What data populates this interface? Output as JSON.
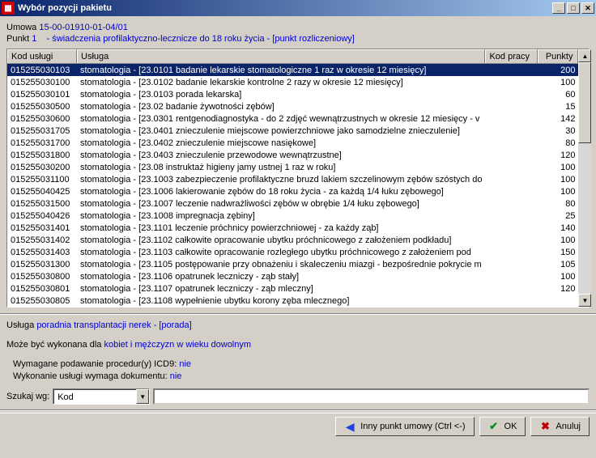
{
  "window": {
    "title": "Wybór pozycji pakietu"
  },
  "header": {
    "umowa_label": "Umowa",
    "umowa_value": "15-00-01910-01-04/01",
    "punkt_label": "Punkt",
    "punkt_value": "1",
    "punkt_desc": "-   świadczenia profilaktyczno-lecznicze do 18 roku życia - [punkt rozliczeniowy]"
  },
  "table": {
    "columns": {
      "kod": "Kod usługi",
      "usluga": "Usługa",
      "kodpracy": "Kod pracy",
      "punkty": "Punkty"
    },
    "rows": [
      {
        "kod": "015255030103",
        "usluga": "stomatologia - [23.0101 badanie lekarskie stomatologiczne 1 raz w okresie 12 miesięcy]",
        "punkty": "200",
        "sel": true
      },
      {
        "kod": "015255030100",
        "usluga": "stomatologia - [23.0102 badanie lekarskie kontrolne 2 razy w okresie 12 miesięcy]",
        "punkty": "100"
      },
      {
        "kod": "015255030101",
        "usluga": "stomatologia - [23.0103 porada lekarska]",
        "punkty": "60"
      },
      {
        "kod": "015255030500",
        "usluga": "stomatologia - [23.02 badanie żywotności zębów]",
        "punkty": "15"
      },
      {
        "kod": "015255030600",
        "usluga": "stomatologia - [23.0301 rentgenodiagnostyka - do 2 zdjęć wewnątrzustnych w okresie 12 miesięcy - v",
        "punkty": "142"
      },
      {
        "kod": "015255031705",
        "usluga": "stomatologia - [23.0401 znieczulenie miejscowe powierzchniowe jako samodzielne znieczulenie]",
        "punkty": "30"
      },
      {
        "kod": "015255031700",
        "usluga": "stomatologia - [23.0402 znieczulenie miejscowe nasiękowe]",
        "punkty": "80"
      },
      {
        "kod": "015255031800",
        "usluga": "stomatologia - [23.0403 znieczulenie przewodowe wewnątrzustne]",
        "punkty": "120"
      },
      {
        "kod": "015255030200",
        "usluga": "stomatologia - [23.08 instruktaż higieny jamy ustnej 1 raz w roku]",
        "punkty": "100"
      },
      {
        "kod": "015255031100",
        "usluga": "stomatologia - [23.1003 zabezpieczenie profilaktyczne bruzd lakiem szczelinowym zębów szóstych do",
        "punkty": "100"
      },
      {
        "kod": "015255040425",
        "usluga": "stomatologia - [23.1006 lakierowanie zębów  do 18 roku życia - za każdą 1/4 łuku zębowego]",
        "punkty": "100"
      },
      {
        "kod": "015255031500",
        "usluga": "stomatologia - [23.1007 leczenie nadwrażliwości zębów w obrębie 1/4 łuku zębowego]",
        "punkty": "80"
      },
      {
        "kod": "015255040426",
        "usluga": "stomatologia - [23.1008 impregnacja zębiny]",
        "punkty": "25"
      },
      {
        "kod": "015255031401",
        "usluga": "stomatologia - [23.1101 leczenie próchnicy powierzchniowej - za każdy ząb]",
        "punkty": "140"
      },
      {
        "kod": "015255031402",
        "usluga": "stomatologia - [23.1102 całkowite opracowanie ubytku próchnicowego z założeniem podkładu]",
        "punkty": "100"
      },
      {
        "kod": "015255031403",
        "usluga": "stomatologia - [23.1103 całkowite opracowanie rozległego ubytku próchnicowego z założeniem pod",
        "punkty": "150"
      },
      {
        "kod": "015255031300",
        "usluga": "stomatologia - [23.1105 postępowanie przy obnażeniu i skaleczeniu miazgi - bezpośrednie pokrycie m",
        "punkty": "105"
      },
      {
        "kod": "015255030800",
        "usluga": "stomatologia - [23.1106 opatrunek leczniczy - ząb stały]",
        "punkty": "100"
      },
      {
        "kod": "015255030801",
        "usluga": "stomatologia - [23.1107 opatrunek leczniczy - ząb mleczny]",
        "punkty": "120"
      },
      {
        "kod": "015255030805",
        "usluga": "stomatologia - [23.1108 wypełnienie ubytku korony zęba mlecznego]",
        "punkty": ""
      }
    ]
  },
  "detail": {
    "usluga_label": "Usługa",
    "usluga_value": "poradnia transplantacji nerek - [porada]",
    "moze_label": "Może być wykonana dla",
    "moze_value": "kobiet i mężczyzn w wieku dowolnym",
    "icd9_label": "Wymagane podawanie procedur(y) ICD9:",
    "icd9_value": "nie",
    "dokument_label": "Wykonanie usługi wymaga dokumentu:",
    "dokument_value": "nie"
  },
  "search": {
    "label": "Szukaj wg:",
    "selected": "Kod",
    "value": ""
  },
  "buttons": {
    "punkt": "Inny punkt umowy (Ctrl <-)",
    "ok": "OK",
    "cancel": "Anuluj"
  }
}
